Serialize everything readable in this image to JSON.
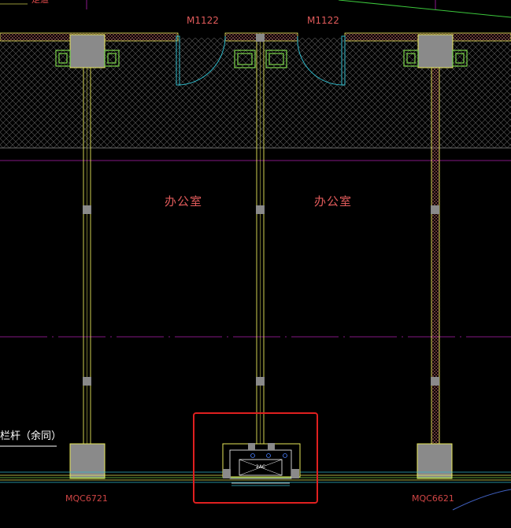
{
  "drawing": {
    "top_fragment": "走道",
    "doors": [
      {
        "id": "door-left",
        "label": "M1122"
      },
      {
        "id": "door-right",
        "label": "M1122"
      }
    ],
    "rooms": [
      {
        "id": "room-left",
        "label": "办公室"
      },
      {
        "id": "room-right",
        "label": "办公室"
      }
    ],
    "railing_note": "栏杆（余同）",
    "walls": [
      {
        "id": "wall-left",
        "label": "MQC6721"
      },
      {
        "id": "wall-right",
        "label": "MQC6621"
      }
    ],
    "equipment": {
      "label": "2AC"
    },
    "colors": {
      "background": "#000000",
      "wall_line": "#e8e85a",
      "hatch": "#6a6a6a",
      "gridline": "#c020c0",
      "door_swing": "#2fb7c8",
      "text_red": "#e05a5a",
      "column": "#8a8a8a",
      "highlight_box": "#e02020",
      "window_green": "#7cd64a"
    }
  }
}
